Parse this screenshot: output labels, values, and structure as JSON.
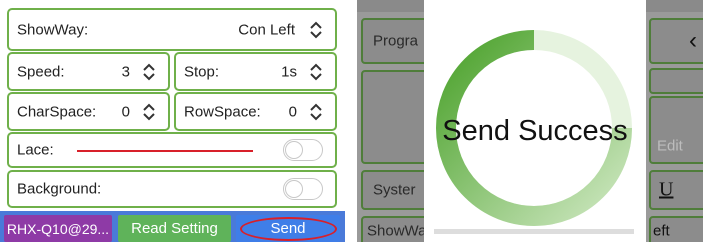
{
  "left": {
    "show_way": {
      "label": "ShowWay:",
      "value": "Con Left"
    },
    "speed": {
      "label": "Speed:",
      "value": "3"
    },
    "stop": {
      "label": "Stop:",
      "value": "1s"
    },
    "char_space": {
      "label": "CharSpace:",
      "value": "0"
    },
    "row_space": {
      "label": "RowSpace:",
      "value": "0"
    },
    "lace": {
      "label": "Lace:",
      "enabled": false
    },
    "background": {
      "label": "Background:",
      "enabled": false
    },
    "buttons": {
      "device": "RHX-Q10@29...",
      "read_setting": "Read Setting",
      "send": "Send"
    }
  },
  "right": {
    "progra_label": "Progra",
    "system_label": "Syster",
    "showway_label": "ShowWa",
    "edit_label": "Edit",
    "underline_glyph": "U",
    "left_value": "eft"
  },
  "dialog": {
    "message": "Send Success",
    "progress_fraction": 0.75
  },
  "colors": {
    "green_border": "#6fb04a",
    "purple": "#8e3aa6",
    "green_btn": "#5fb35a",
    "send_btn": "#3f7ee8",
    "annotation_red": "#d8202a"
  }
}
